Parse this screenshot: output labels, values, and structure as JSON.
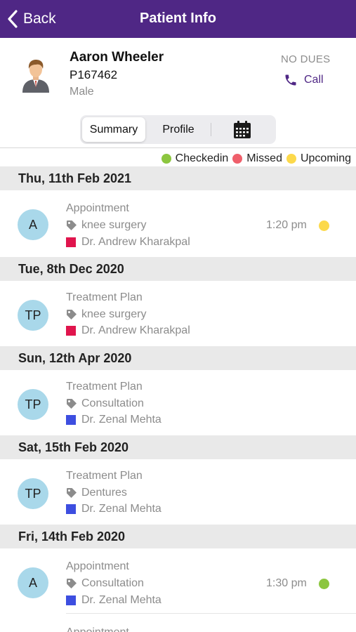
{
  "header": {
    "back_label": "Back",
    "title": "Patient Info"
  },
  "patient": {
    "name": "Aaron Wheeler",
    "id": "P167462",
    "gender": "Male",
    "dues": "NO DUES",
    "call_label": "Call",
    "avatar_icon": "person-avatar-icon"
  },
  "tabs": {
    "summary": "Summary",
    "profile": "Profile",
    "calendar_icon": "calendar-icon",
    "active": "Summary"
  },
  "legend": [
    {
      "label": "Checkedin",
      "color": "#8cc63f"
    },
    {
      "label": "Missed",
      "color": "#ef5f6b"
    },
    {
      "label": "Upcoming",
      "color": "#fcd94b"
    }
  ],
  "groups": [
    {
      "date": "Thu, 11th Feb 2021",
      "entries": [
        {
          "initials": "A",
          "type": "Appointment",
          "procedure": "knee surgery",
          "doctor": "Dr. Andrew Kharakpal",
          "doctor_color": "#e0154d",
          "time": "1:20 pm",
          "status_color": "#fcd94b"
        }
      ]
    },
    {
      "date": "Tue, 8th Dec 2020",
      "entries": [
        {
          "initials": "TP",
          "type": "Treatment Plan",
          "procedure": "knee surgery",
          "doctor": "Dr. Andrew Kharakpal",
          "doctor_color": "#e0154d"
        }
      ]
    },
    {
      "date": "Sun, 12th Apr 2020",
      "entries": [
        {
          "initials": "TP",
          "type": "Treatment Plan",
          "procedure": "Consultation",
          "doctor": "Dr. Zenal Mehta",
          "doctor_color": "#3d4ee0"
        }
      ]
    },
    {
      "date": "Sat, 15th Feb 2020",
      "entries": [
        {
          "initials": "TP",
          "type": "Treatment Plan",
          "procedure": "Dentures",
          "doctor": "Dr. Zenal Mehta",
          "doctor_color": "#3d4ee0"
        }
      ]
    },
    {
      "date": "Fri, 14th Feb 2020",
      "entries": [
        {
          "initials": "A",
          "type": "Appointment",
          "procedure": "Consultation",
          "doctor": "Dr. Zenal Mehta",
          "doctor_color": "#3d4ee0",
          "time": "1:30 pm",
          "status_color": "#8cc63f"
        },
        {
          "type": "Appointment"
        }
      ]
    }
  ]
}
